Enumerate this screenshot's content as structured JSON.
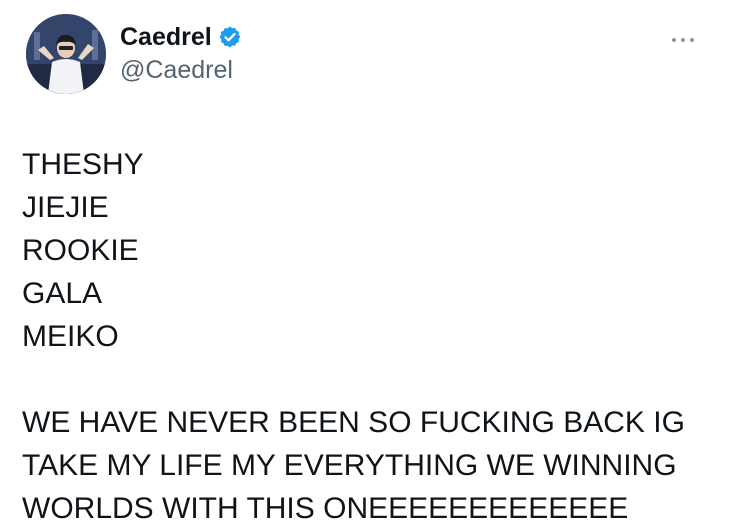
{
  "tweet": {
    "author": {
      "display_name": "Caedrel",
      "handle": "@Caedrel",
      "verified": true,
      "verified_color": "#1d9bf0",
      "avatar_icon": "profile-photo"
    },
    "more_icon": "more-options-icon",
    "roster_lines": [
      "THESHY",
      "JIEJIE",
      "ROOKIE",
      "GALA",
      "MEIKO"
    ],
    "message_lines": [
      "WE HAVE NEVER BEEN SO FUCKING BACK IG",
      "TAKE MY LIFE MY EVERYTHING WE WINNING",
      "WORLDS WITH THIS ONEEEEEEEEEEEEE"
    ]
  }
}
